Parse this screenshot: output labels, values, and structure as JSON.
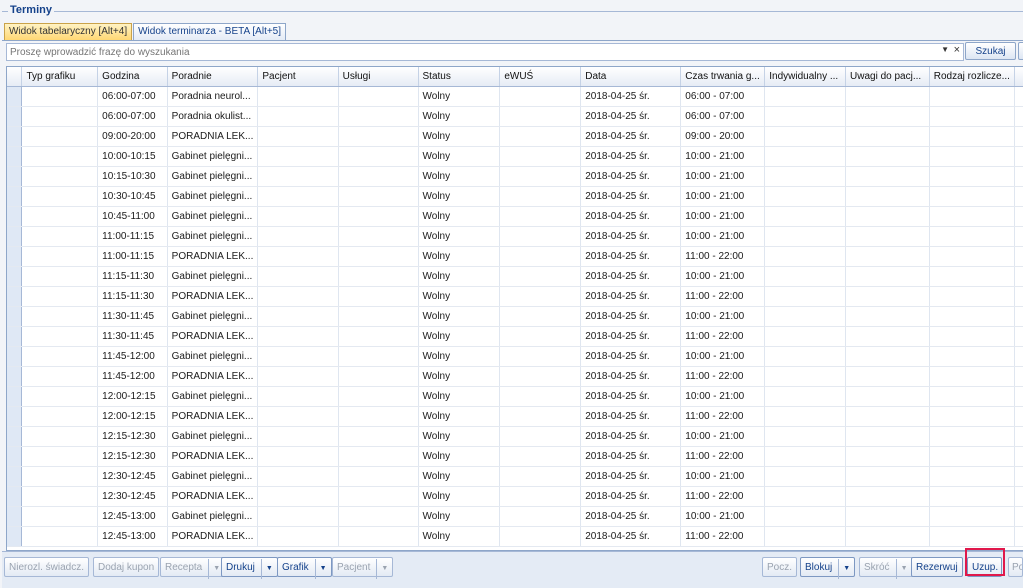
{
  "panel": {
    "title": "Terminy"
  },
  "tabs": [
    {
      "label": "Widok tabelaryczny [Alt+4]",
      "active": true
    },
    {
      "label": "Widok terminarza - BETA [Alt+5]",
      "active": false
    }
  ],
  "search": {
    "placeholder": "Proszę wprowadzić frazę do wyszukania",
    "button": "Szukaj",
    "dropdown_icon": "chevron-down-icon",
    "clear_icon": "close-icon"
  },
  "columns": [
    "Typ grafiku",
    "Godzina",
    "Poradnie",
    "Pacjent",
    "Usługi",
    "Status",
    "eWUŚ",
    "Data",
    "Czas trwania g...",
    "Indywidualny ...",
    "Uwagi do pacj...",
    "Rodzaj rozlicze..."
  ],
  "rows": [
    [
      "",
      "06:00-07:00",
      "Poradnia neurol...",
      "",
      "",
      "Wolny",
      "",
      "2018-04-25 śr.",
      "06:00 - 07:00",
      "",
      "",
      ""
    ],
    [
      "",
      "06:00-07:00",
      "Poradnia okulist...",
      "",
      "",
      "Wolny",
      "",
      "2018-04-25 śr.",
      "06:00 - 07:00",
      "",
      "",
      ""
    ],
    [
      "",
      "09:00-20:00",
      "PORADNIA LEK...",
      "",
      "",
      "Wolny",
      "",
      "2018-04-25 śr.",
      "09:00 - 20:00",
      "",
      "",
      ""
    ],
    [
      "",
      "10:00-10:15",
      "Gabinet pielęgni...",
      "",
      "",
      "Wolny",
      "",
      "2018-04-25 śr.",
      "10:00 - 21:00",
      "",
      "",
      ""
    ],
    [
      "",
      "10:15-10:30",
      "Gabinet pielęgni...",
      "",
      "",
      "Wolny",
      "",
      "2018-04-25 śr.",
      "10:00 - 21:00",
      "",
      "",
      ""
    ],
    [
      "",
      "10:30-10:45",
      "Gabinet pielęgni...",
      "",
      "",
      "Wolny",
      "",
      "2018-04-25 śr.",
      "10:00 - 21:00",
      "",
      "",
      ""
    ],
    [
      "",
      "10:45-11:00",
      "Gabinet pielęgni...",
      "",
      "",
      "Wolny",
      "",
      "2018-04-25 śr.",
      "10:00 - 21:00",
      "",
      "",
      ""
    ],
    [
      "",
      "11:00-11:15",
      "Gabinet pielęgni...",
      "",
      "",
      "Wolny",
      "",
      "2018-04-25 śr.",
      "10:00 - 21:00",
      "",
      "",
      ""
    ],
    [
      "",
      "11:00-11:15",
      "PORADNIA LEK...",
      "",
      "",
      "Wolny",
      "",
      "2018-04-25 śr.",
      "11:00 - 22:00",
      "",
      "",
      ""
    ],
    [
      "",
      "11:15-11:30",
      "Gabinet pielęgni...",
      "",
      "",
      "Wolny",
      "",
      "2018-04-25 śr.",
      "10:00 - 21:00",
      "",
      "",
      ""
    ],
    [
      "",
      "11:15-11:30",
      "PORADNIA LEK...",
      "",
      "",
      "Wolny",
      "",
      "2018-04-25 śr.",
      "11:00 - 22:00",
      "",
      "",
      ""
    ],
    [
      "",
      "11:30-11:45",
      "Gabinet pielęgni...",
      "",
      "",
      "Wolny",
      "",
      "2018-04-25 śr.",
      "10:00 - 21:00",
      "",
      "",
      ""
    ],
    [
      "",
      "11:30-11:45",
      "PORADNIA LEK...",
      "",
      "",
      "Wolny",
      "",
      "2018-04-25 śr.",
      "11:00 - 22:00",
      "",
      "",
      ""
    ],
    [
      "",
      "11:45-12:00",
      "Gabinet pielęgni...",
      "",
      "",
      "Wolny",
      "",
      "2018-04-25 śr.",
      "10:00 - 21:00",
      "",
      "",
      ""
    ],
    [
      "",
      "11:45-12:00",
      "PORADNIA LEK...",
      "",
      "",
      "Wolny",
      "",
      "2018-04-25 śr.",
      "11:00 - 22:00",
      "",
      "",
      ""
    ],
    [
      "",
      "12:00-12:15",
      "Gabinet pielęgni...",
      "",
      "",
      "Wolny",
      "",
      "2018-04-25 śr.",
      "10:00 - 21:00",
      "",
      "",
      ""
    ],
    [
      "",
      "12:00-12:15",
      "PORADNIA LEK...",
      "",
      "",
      "Wolny",
      "",
      "2018-04-25 śr.",
      "11:00 - 22:00",
      "",
      "",
      ""
    ],
    [
      "",
      "12:15-12:30",
      "Gabinet pielęgni...",
      "",
      "",
      "Wolny",
      "",
      "2018-04-25 śr.",
      "10:00 - 21:00",
      "",
      "",
      ""
    ],
    [
      "",
      "12:15-12:30",
      "PORADNIA LEK...",
      "",
      "",
      "Wolny",
      "",
      "2018-04-25 śr.",
      "11:00 - 22:00",
      "",
      "",
      ""
    ],
    [
      "",
      "12:30-12:45",
      "Gabinet pielęgni...",
      "",
      "",
      "Wolny",
      "",
      "2018-04-25 śr.",
      "10:00 - 21:00",
      "",
      "",
      ""
    ],
    [
      "",
      "12:30-12:45",
      "PORADNIA LEK...",
      "",
      "",
      "Wolny",
      "",
      "2018-04-25 śr.",
      "11:00 - 22:00",
      "",
      "",
      ""
    ],
    [
      "",
      "12:45-13:00",
      "Gabinet pielęgni...",
      "",
      "",
      "Wolny",
      "",
      "2018-04-25 śr.",
      "10:00 - 21:00",
      "",
      "",
      ""
    ],
    [
      "",
      "12:45-13:00",
      "PORADNIA LEK...",
      "",
      "",
      "Wolny",
      "",
      "2018-04-25 śr.",
      "11:00 - 22:00",
      "",
      "",
      ""
    ]
  ],
  "toolbar": {
    "nierozl": "Nierozl. świadcz.",
    "dodaj_kupon": "Dodaj kupon",
    "recepta": "Recepta",
    "drukuj": "Drukuj",
    "grafik": "Grafik",
    "pacjent": "Pacjent",
    "pocz": "Pocz.",
    "blokuj": "Blokuj",
    "skroc": "Skróć",
    "rezerwuj": "Rezerwuj",
    "uzup": "Uzup.",
    "po": "Po"
  },
  "colors": {
    "accent": "#15428b",
    "highlight": "#e0184b",
    "active_tab": "#ffd774"
  }
}
